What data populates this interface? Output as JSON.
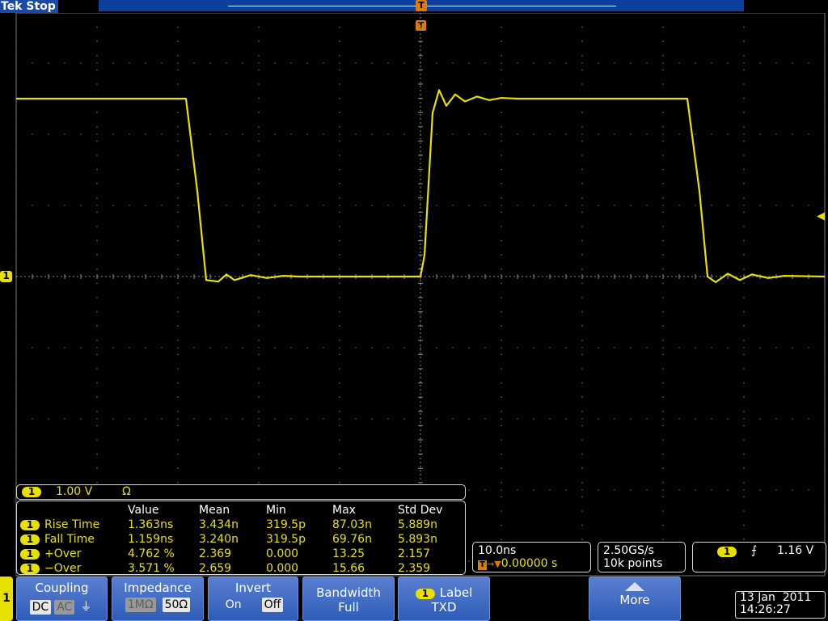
{
  "header": {
    "brand": "Tek",
    "status": "Stop",
    "trigger_marker": "T"
  },
  "channel": {
    "id": "1",
    "scale": "1.00 V",
    "termination": "Ω",
    "color": "#e8e000"
  },
  "measurements": {
    "columns": [
      "Value",
      "Mean",
      "Min",
      "Max",
      "Std Dev"
    ],
    "rows": [
      {
        "ch": "1",
        "name": "Rise Time",
        "value": "1.363ns",
        "mean": "3.434n",
        "min": "319.5p",
        "max": "87.03n",
        "std": "5.889n"
      },
      {
        "ch": "1",
        "name": "Fall Time",
        "value": "1.159ns",
        "mean": "3.240n",
        "min": "319.5p",
        "max": "69.76n",
        "std": "5.893n"
      },
      {
        "ch": "1",
        "name": "+Over",
        "value": "4.762 %",
        "mean": "2.369",
        "min": "0.000",
        "max": "13.25",
        "std": "2.157"
      },
      {
        "ch": "1",
        "name": "−Over",
        "value": "3.571 %",
        "mean": "2.659",
        "min": "0.000",
        "max": "15.66",
        "std": "2.359"
      }
    ]
  },
  "timebase": {
    "scale": "10.0ns",
    "delay": "0.00000 s"
  },
  "acquisition": {
    "sample_rate": "2.50GS/s",
    "record_length": "10k points"
  },
  "trigger": {
    "source": "1",
    "slope_icon": "rising-edge-icon",
    "level": "1.16 V"
  },
  "bottom_menu": {
    "channel": "1",
    "coupling": {
      "title": "Coupling",
      "dc": "DC",
      "ac": "AC",
      "gnd_icon": "ground-icon"
    },
    "impedance": {
      "title": "Impedance",
      "one_meg": "1MΩ",
      "fifty": "50Ω"
    },
    "invert": {
      "title": "Invert",
      "on": "On",
      "off": "Off"
    },
    "bandwidth": {
      "title": "Bandwidth",
      "value": "Full"
    },
    "label": {
      "ch": "1",
      "title": "Label",
      "value": "TXD"
    },
    "more": {
      "title": "More",
      "icon": "up-arrow-icon"
    }
  },
  "datetime": {
    "date": "13 Jan  2011",
    "time": "14:26:27"
  },
  "chart_data": {
    "type": "line",
    "title": "",
    "xlabel": "",
    "ylabel": "",
    "x_per_div": "10.0ns",
    "y_per_div": "1.00 V",
    "grid": true,
    "series": [
      {
        "x_ns": [
          -50,
          -29,
          -27.6,
          -26.5,
          -25,
          -24,
          -23,
          -21,
          -19,
          -17,
          -15,
          0,
          0.5,
          1,
          1.5,
          2.3,
          3.2,
          4.3,
          5.5,
          7,
          8.5,
          10,
          12,
          33,
          34.5,
          35.5,
          36.5,
          38,
          39.5,
          41,
          43,
          45,
          50
        ],
        "y_div": [
          2.5,
          2.5,
          1.2,
          -0.05,
          -0.07,
          0.03,
          -0.05,
          0.02,
          -0.02,
          0.01,
          0.0,
          0.0,
          0.3,
          1.3,
          2.3,
          2.62,
          2.4,
          2.56,
          2.46,
          2.53,
          2.48,
          2.51,
          2.5,
          2.5,
          1.2,
          0.0,
          -0.08,
          0.04,
          -0.05,
          0.03,
          -0.02,
          0.01,
          0.0
        ]
      }
    ]
  }
}
